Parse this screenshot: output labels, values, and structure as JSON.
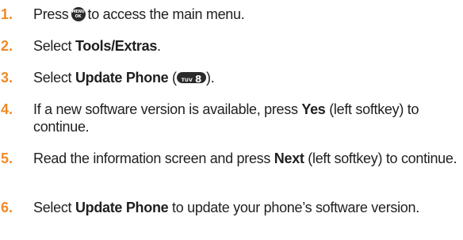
{
  "steps": [
    {
      "number": "1.",
      "pre": "Press",
      "key": {
        "top": "MENU",
        "bottom": "OK"
      },
      "post": "to access the main menu."
    },
    {
      "number": "2.",
      "pre": "Select ",
      "bold": "Tools/Extras",
      "post": "."
    },
    {
      "number": "3.",
      "pre": "Select ",
      "bold": "Update Phone",
      "mid": " (",
      "key": {
        "letters": "TUV",
        "digit": "8"
      },
      "post": ")."
    },
    {
      "number": "4.",
      "pre": "If a new software version is available, press ",
      "bold": "Yes",
      "post": " (left softkey) to continue."
    },
    {
      "number": "5.",
      "pre": "Read the information screen and press ",
      "bold": "Next",
      "post": " (left softkey) to continue."
    },
    {
      "number": "6.",
      "pre": "Select ",
      "bold": "Update Phone",
      "post": " to update your phone’s software version."
    }
  ],
  "colors": {
    "step_number": "#f08a24",
    "body_text": "#1f1f1f",
    "key_background": "#2b2b2b"
  }
}
